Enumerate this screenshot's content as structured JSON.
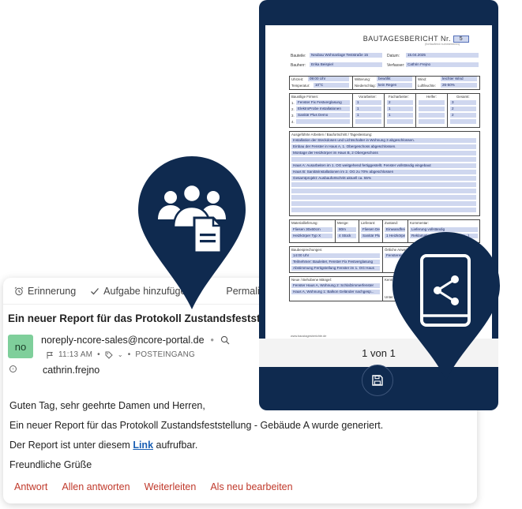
{
  "mail": {
    "toolbar": {
      "reminder": "Erinnerung",
      "add_task": "Aufgabe hinzufügen",
      "permalink": "Permalink"
    },
    "subject": "Ein neuer Report für das Protokoll Zustandsfeststellung -",
    "avatar_initials": "no",
    "sender": "noreply-ncore-sales@ncore-portal.de",
    "time": "11:13 AM",
    "folder": "POSTEINGANG",
    "recipient": "cathrin.frejno",
    "body": {
      "greeting": "Guten Tag, sehr geehrte Damen und Herren,",
      "line1": "Ein neuer Report für das Protokoll Zustandsfeststellung - Gebäude A wurde generiert.",
      "line2_before": "Der Report ist unter diesem",
      "link": "Link",
      "line2_after": "aufrufbar.",
      "closing": "Freundliche Grüße"
    },
    "actions": {
      "reply": "Antwort",
      "reply_all": "Allen antworten",
      "forward": "Weiterleiten",
      "edit_new": "Als neu bearbeiten"
    }
  },
  "viewer": {
    "page_indicator": "1 von 1",
    "doc": {
      "title": "BAUTAGESBERICHT Nr.",
      "number": "5",
      "subtitle": "(fortlaufend nummerieren)",
      "labels": {
        "project": "Bauteile:",
        "date": "Datum:",
        "client": "Bauherr:",
        "author": "Verfasser:",
        "time": "Uhrzeit:",
        "weather": "Witterung:",
        "wind": "Wind:",
        "temp": "Temperatur:",
        "precip": "Niederschlag:",
        "humidity": "Luftfeuchte:",
        "firms": "Baustlige Firmen:",
        "foremen": "Vorarbeiter:",
        "skilled": "Facharbeiter:",
        "helpers": "Helfer:",
        "total": "Gesamt:",
        "work": "Ausgeführte Arbeiten / Baufortschritt / Tagesleistung:",
        "material": "Materiallieferung:",
        "quantity": "Menge:",
        "supplier": "Lieferant:",
        "state": "Zustand:",
        "comment": "Kommentar:",
        "meetings": "Baubesprechungen:",
        "local_insp": "Örtliche Anwei...",
        "defects": "Neue / Behobene Mängel:",
        "known": "Kennt...",
        "signature": "Unter..."
      },
      "values": {
        "project": "Neubau Wohnanlage Teststraße 15",
        "date": "15.04.2025",
        "client": "Erika Beispiel",
        "author": "Cathrin Frejno",
        "time": "09:00 Uhr",
        "weather": "bewölkt",
        "wind": "leichter Wind",
        "temp": "10°C",
        "precip": "kein Regen",
        "humidity": "26-50%",
        "firms": [
          "Fenster Fix Festverglasung",
          "ElektroProbe Installationen",
          "Sanitär Plus Demo",
          ""
        ],
        "foremen": [
          "1",
          "1",
          "1",
          ""
        ],
        "skilled": [
          "2",
          "1",
          "1",
          ""
        ],
        "helpers": [
          "",
          "",
          "",
          ""
        ],
        "total": [
          "3",
          "2",
          "2",
          ""
        ],
        "work": [
          "Installation der Steckdosen und Lichtschalter in Wohnung 3 abgeschlossen.",
          "Einbau der Fenster in Haus A, 1. Obergeschoss abgeschlossen.",
          "Montage der Heizkörper im Haus B, 2 Obergeschoss",
          "",
          "Haus A: Ausarbeiten im 1. OG weitgehend fertiggestellt. Fenster vollständig eingebaut",
          "Haus B: Sanitärinstallationen im 2. OG zu 70% abgeschlossen",
          "Gesamtprojekt: Ausbaufortschritt aktuell ca. 55%"
        ],
        "materials": [
          "Fliesen 30x60cm",
          "Heizkörper Typ X"
        ],
        "quantities": [
          "80m",
          "4 Stück"
        ],
        "suppliers": [
          "Fliesen Den",
          "Sanitär Plus"
        ],
        "states": [
          "Einwandfrei",
          "1 Heizkörpe"
        ],
        "comments": [
          "Lieferung vollständig",
          "Reklamation an Lieferant (Liefers...)"
        ],
        "meetings": [
          "14:00 Uhr",
          "Teilnehmer: Bauleiter, Fenster Fix Festverglasung",
          "Abstimmung Fertigstellung Fenster im 1. OG Haus"
        ],
        "local_insp": "Fenstereinb...",
        "defects": [
          "Fenster Haus A, Wohnung 2: Schlafzimmerfenster",
          "Haus A, Wohnung 1: Balkon Geländer nachgesp..."
        ]
      },
      "footer": "www.baustagesberichte.de"
    }
  },
  "colors": {
    "navy": "#0f2a4f",
    "action_red": "#c0392b",
    "link_blue": "#1a5fb4",
    "avatar_green": "#7fcf9b",
    "form_fill": "#cfd7ef"
  },
  "icons": {
    "pin_left": "team-document-icon",
    "pin_right": "phone-share-icon"
  }
}
